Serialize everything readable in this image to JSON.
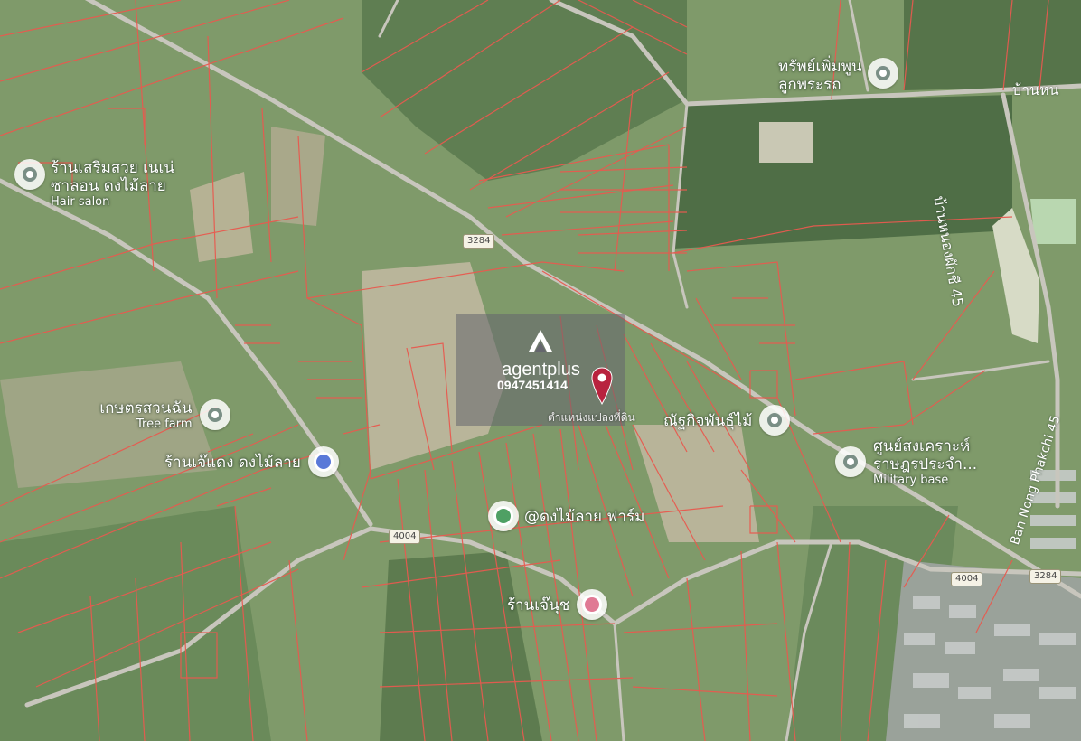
{
  "map": {
    "attribution_colors": {
      "parcel": "#e85a4f",
      "road": "#c8c6bd",
      "field": "#8fa77a"
    }
  },
  "agent": {
    "brand": "agentplus",
    "phone": "0947451414",
    "marker_label": "ตำแหน่งแปลงที่ดิน"
  },
  "pois": [
    {
      "name": "ทรัพย์เพิ่มพูน",
      "name2": "ลูกพระรถ",
      "sub": "",
      "icon": "place-icon"
    },
    {
      "name": "ร้านเสริมสวย เนเน่",
      "name2": "ซาลอน ดงไม้ลาย",
      "sub": "Hair salon",
      "icon": "place-icon"
    },
    {
      "name": "เกษตรสวนฉัน",
      "name2": "",
      "sub": "Tree farm",
      "icon": "place-icon"
    },
    {
      "name": "ร้านเจ๊แดง ดงไม้ลาย",
      "name2": "",
      "sub": "",
      "icon": "shop-icon"
    },
    {
      "name": "@ดงไม้ลาย ฟาร์ม",
      "name2": "",
      "sub": "",
      "icon": "farm-icon"
    },
    {
      "name": "ร้านเจ๊นุช",
      "name2": "",
      "sub": "",
      "icon": "shop-icon"
    },
    {
      "name": "ณัฐกิจพันธุ์ไม้",
      "name2": "",
      "sub": "",
      "icon": "place-icon"
    },
    {
      "name": "ศูนย์สงเคราะห์",
      "name2": "ราษฎรประจำ...",
      "sub": "Military base",
      "icon": "place-icon"
    }
  ],
  "roads": {
    "shield_3284": "3284",
    "shield_4004": "4004",
    "name_nong_phakchi": "บ้านหนองผักชี 45",
    "name_nong_phakchi_en": "Ban Nong Phakchi 45",
    "name_ban_nong": "บ้านหน"
  }
}
